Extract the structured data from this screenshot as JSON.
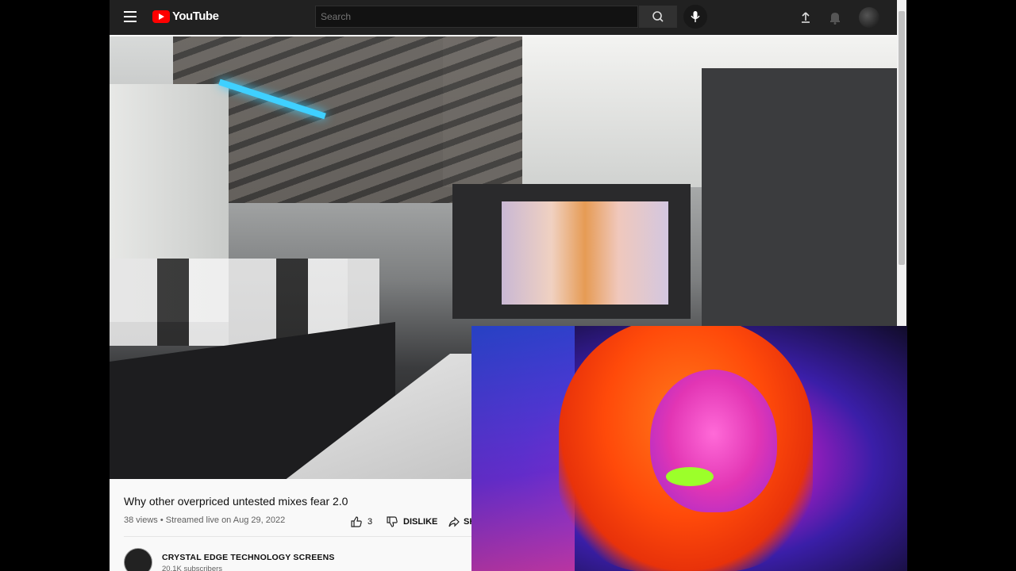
{
  "header": {
    "logo_text": "YouTube",
    "search_placeholder": "Search",
    "icons": [
      "menu-icon",
      "search-icon",
      "microphone-icon",
      "upload-icon",
      "bell-icon",
      "avatar"
    ]
  },
  "video": {
    "title": "Why other overpriced untested mixes fear 2.0",
    "meta": "38 views • Streamed live on Aug 29, 2022",
    "like_count": "3",
    "dislike_label": "DISLIKE",
    "share_label": "SH"
  },
  "channel": {
    "name": "CRYSTAL EDGE TECHNOLOGY SCREENS",
    "subscribers": "20.1K subscribers"
  },
  "colors": {
    "header_bg": "#212121",
    "brand_red": "#ff0000",
    "page_bg": "#f9f9f9"
  }
}
